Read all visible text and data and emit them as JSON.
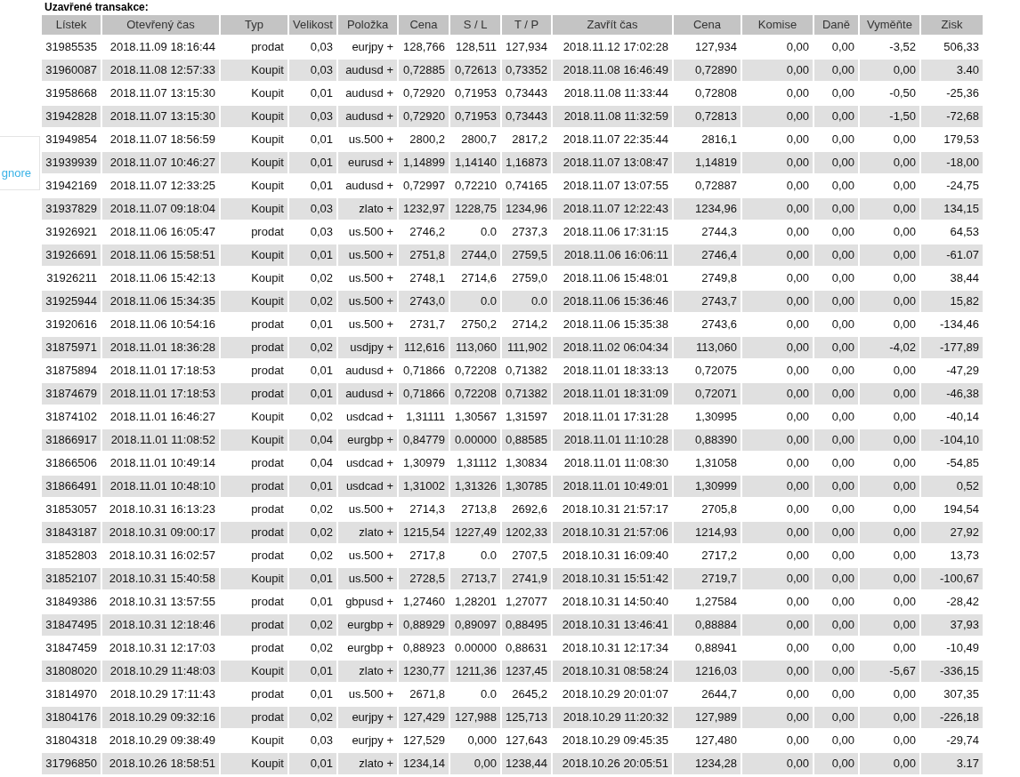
{
  "section_title": "Uzavřené transakce:",
  "side_panel": {
    "link": "gnore"
  },
  "table": {
    "columns": [
      "Lístek",
      "Otevřený čas",
      "Typ",
      "Velikost",
      "Položka",
      "Cena",
      "S / L",
      "T / P",
      "Zavřít čas",
      "Cena",
      "Komise",
      "Daně",
      "Vyměňte",
      "Zisk"
    ],
    "rows": [
      [
        "31985535",
        "2018.11.09 18:16:44",
        "prodat",
        "0,03",
        "eurjpy +",
        "128,766",
        "128,511",
        "127,934",
        "2018.11.12 17:02:28",
        "127,934",
        "0,00",
        "0,00",
        "-3,52",
        "506,33"
      ],
      [
        "31960087",
        "2018.11.08 12:57:33",
        "Koupit",
        "0,03",
        "audusd +",
        "0,72885",
        "0,72613",
        "0,73352",
        "2018.11.08 16:46:49",
        "0,72890",
        "0,00",
        "0,00",
        "0,00",
        "3.40"
      ],
      [
        "31958668",
        "2018.11.07 13:15:30",
        "Koupit",
        "0,01",
        "audusd +",
        "0,72920",
        "0,71953",
        "0,73443",
        "2018.11.08 11:33:44",
        "0,72808",
        "0,00",
        "0,00",
        "-0,50",
        "-25,36"
      ],
      [
        "31942828",
        "2018.11.07 13:15:30",
        "Koupit",
        "0,03",
        "audusd +",
        "0,72920",
        "0,71953",
        "0,73443",
        "2018.11.08 11:32:59",
        "0,72813",
        "0,00",
        "0,00",
        "-1,50",
        "-72,68"
      ],
      [
        "31949854",
        "2018.11.07 18:56:59",
        "Koupit",
        "0,01",
        "us.500 +",
        "2800,2",
        "2800,7",
        "2817,2",
        "2018.11.07 22:35:44",
        "2816,1",
        "0,00",
        "0,00",
        "0,00",
        "179,53"
      ],
      [
        "31939939",
        "2018.11.07 10:46:27",
        "Koupit",
        "0,01",
        "eurusd +",
        "1,14899",
        "1,14140",
        "1,16873",
        "2018.11.07 13:08:47",
        "1,14819",
        "0,00",
        "0,00",
        "0,00",
        "-18,00"
      ],
      [
        "31942169",
        "2018.11.07 12:33:25",
        "Koupit",
        "0,01",
        "audusd +",
        "0,72997",
        "0,72210",
        "0,74165",
        "2018.11.07 13:07:55",
        "0,72887",
        "0,00",
        "0,00",
        "0,00",
        "-24,75"
      ],
      [
        "31937829",
        "2018.11.07 09:18:04",
        "Koupit",
        "0,03",
        "zlato +",
        "1232,97",
        "1228,75",
        "1234,96",
        "2018.11.07 12:22:43",
        "1234,96",
        "0,00",
        "0,00",
        "0,00",
        "134,15"
      ],
      [
        "31926921",
        "2018.11.06 16:05:47",
        "prodat",
        "0,03",
        "us.500 +",
        "2746,2",
        "0.0",
        "2737,3",
        "2018.11.06 17:31:15",
        "2744,3",
        "0,00",
        "0,00",
        "0,00",
        "64,53"
      ],
      [
        "31926691",
        "2018.11.06 15:58:51",
        "Koupit",
        "0,01",
        "us.500 +",
        "2751,8",
        "2744,0",
        "2759,5",
        "2018.11.06 16:06:11",
        "2746,4",
        "0,00",
        "0,00",
        "0,00",
        "-61.07"
      ],
      [
        "31926211",
        "2018.11.06 15:42:13",
        "Koupit",
        "0,02",
        "us.500 +",
        "2748,1",
        "2714,6",
        "2759,0",
        "2018.11.06 15:48:01",
        "2749,8",
        "0,00",
        "0,00",
        "0,00",
        "38,44"
      ],
      [
        "31925944",
        "2018.11.06 15:34:35",
        "Koupit",
        "0,02",
        "us.500 +",
        "2743,0",
        "0.0",
        "0.0",
        "2018.11.06 15:36:46",
        "2743,7",
        "0,00",
        "0,00",
        "0,00",
        "15,82"
      ],
      [
        "31920616",
        "2018.11.06 10:54:16",
        "prodat",
        "0,01",
        "us.500 +",
        "2731,7",
        "2750,2",
        "2714,2",
        "2018.11.06 15:35:38",
        "2743,6",
        "0,00",
        "0,00",
        "0,00",
        "-134,46"
      ],
      [
        "31875971",
        "2018.11.01 18:36:28",
        "prodat",
        "0,02",
        "usdjpy +",
        "112,616",
        "113,060",
        "111,902",
        "2018.11.02 06:04:34",
        "113,060",
        "0,00",
        "0,00",
        "-4,02",
        "-177,89"
      ],
      [
        "31875894",
        "2018.11.01 17:18:53",
        "prodat",
        "0,01",
        "audusd +",
        "0,71866",
        "0,72208",
        "0,71382",
        "2018.11.01 18:33:13",
        "0,72075",
        "0,00",
        "0,00",
        "0,00",
        "-47,29"
      ],
      [
        "31874679",
        "2018.11.01 17:18:53",
        "prodat",
        "0,01",
        "audusd +",
        "0,71866",
        "0,72208",
        "0,71382",
        "2018.11.01 18:31:09",
        "0,72071",
        "0,00",
        "0,00",
        "0,00",
        "-46,38"
      ],
      [
        "31874102",
        "2018.11.01 16:46:27",
        "Koupit",
        "0,02",
        "usdcad +",
        "1,31111",
        "1,30567",
        "1,31597",
        "2018.11.01 17:31:28",
        "1,30995",
        "0,00",
        "0,00",
        "0,00",
        "-40,14"
      ],
      [
        "31866917",
        "2018.11.01 11:08:52",
        "Koupit",
        "0,04",
        "eurgbp +",
        "0,84779",
        "0.00000",
        "0,88585",
        "2018.11.01 11:10:28",
        "0,88390",
        "0,00",
        "0,00",
        "0,00",
        "-104,10"
      ],
      [
        "31866506",
        "2018.11.01 10:49:14",
        "prodat",
        "0,04",
        "usdcad +",
        "1,30979",
        "1,31112",
        "1,30834",
        "2018.11.01 11:08:30",
        "1,31058",
        "0,00",
        "0,00",
        "0,00",
        "-54,85"
      ],
      [
        "31866491",
        "2018.11.01 10:48:10",
        "prodat",
        "0,01",
        "usdcad +",
        "1,31002",
        "1,31326",
        "1,30785",
        "2018.11.01 10:49:01",
        "1,30999",
        "0,00",
        "0,00",
        "0,00",
        "0,52"
      ],
      [
        "31853057",
        "2018.10.31 16:13:23",
        "prodat",
        "0,02",
        "us.500 +",
        "2714,3",
        "2713,8",
        "2692,6",
        "2018.10.31 21:57:17",
        "2705,8",
        "0,00",
        "0,00",
        "0,00",
        "194,54"
      ],
      [
        "31843187",
        "2018.10.31 09:00:17",
        "prodat",
        "0,02",
        "zlato +",
        "1215,54",
        "1227,49",
        "1202,33",
        "2018.10.31 21:57:06",
        "1214,93",
        "0,00",
        "0,00",
        "0,00",
        "27,92"
      ],
      [
        "31852803",
        "2018.10.31 16:02:57",
        "prodat",
        "0,02",
        "us.500 +",
        "2717,8",
        "0.0",
        "2707,5",
        "2018.10.31 16:09:40",
        "2717,2",
        "0,00",
        "0,00",
        "0,00",
        "13,73"
      ],
      [
        "31852107",
        "2018.10.31 15:40:58",
        "Koupit",
        "0,01",
        "us.500 +",
        "2728,5",
        "2713,7",
        "2741,9",
        "2018.10.31 15:51:42",
        "2719,7",
        "0,00",
        "0,00",
        "0,00",
        "-100,67"
      ],
      [
        "31849386",
        "2018.10.31 13:57:55",
        "prodat",
        "0,01",
        "gbpusd +",
        "1,27460",
        "1,28201",
        "1,27077",
        "2018.10.31 14:50:40",
        "1,27584",
        "0,00",
        "0,00",
        "0,00",
        "-28,42"
      ],
      [
        "31847495",
        "2018.10.31 12:18:46",
        "prodat",
        "0,02",
        "eurgbp +",
        "0,88929",
        "0,89097",
        "0,88495",
        "2018.10.31 13:46:41",
        "0,88884",
        "0,00",
        "0,00",
        "0,00",
        "37,93"
      ],
      [
        "31847459",
        "2018.10.31 12:17:03",
        "prodat",
        "0,02",
        "eurgbp +",
        "0,88923",
        "0.00000",
        "0,88631",
        "2018.10.31 12:17:34",
        "0,88941",
        "0,00",
        "0,00",
        "0,00",
        "-10,49"
      ],
      [
        "31808020",
        "2018.10.29 11:48:03",
        "Koupit",
        "0,01",
        "zlato +",
        "1230,77",
        "1211,36",
        "1237,45",
        "2018.10.31 08:58:24",
        "1216,03",
        "0,00",
        "0,00",
        "-5,67",
        "-336,15"
      ],
      [
        "31814970",
        "2018.10.29 17:11:43",
        "prodat",
        "0,01",
        "us.500 +",
        "2671,8",
        "0.0",
        "2645,2",
        "2018.10.29 20:01:07",
        "2644,7",
        "0,00",
        "0,00",
        "0,00",
        "307,35"
      ],
      [
        "31804176",
        "2018.10.29 09:32:16",
        "prodat",
        "0,02",
        "eurjpy +",
        "127,429",
        "127,988",
        "125,713",
        "2018.10.29 11:20:32",
        "127,989",
        "0,00",
        "0,00",
        "0,00",
        "-226,18"
      ],
      [
        "31804318",
        "2018.10.29 09:38:49",
        "Koupit",
        "0,03",
        "eurjpy +",
        "127,529",
        "0,000",
        "127,643",
        "2018.10.29 09:45:35",
        "127,480",
        "0,00",
        "0,00",
        "0,00",
        "-29,74"
      ],
      [
        "31796850",
        "2018.10.26 18:58:51",
        "Koupit",
        "0,01",
        "zlato +",
        "1234,14",
        "0,00",
        "1238,44",
        "2018.10.26 20:05:51",
        "1234,28",
        "0,00",
        "0,00",
        "0,00",
        "3.17"
      ]
    ]
  }
}
